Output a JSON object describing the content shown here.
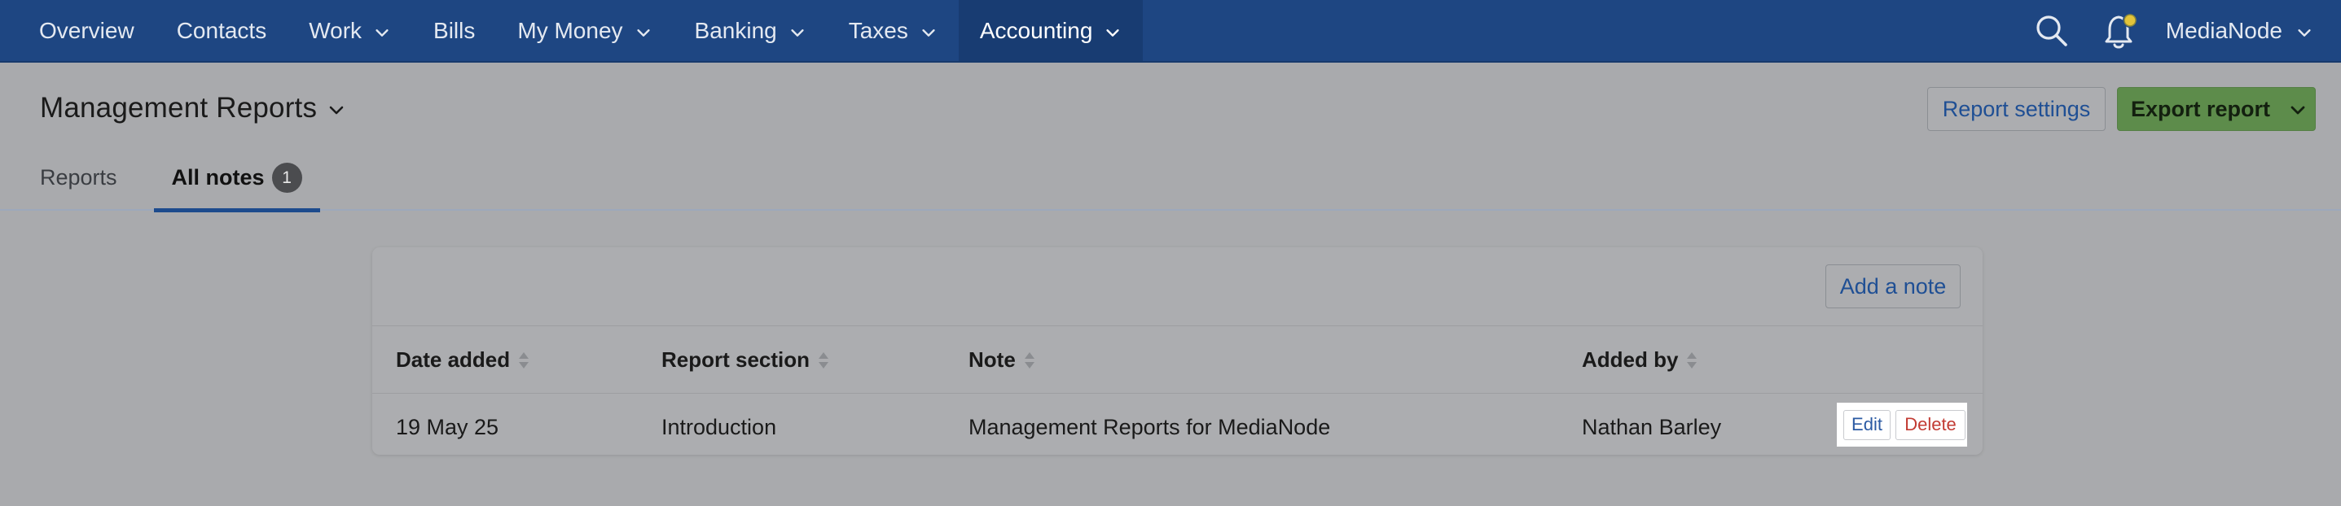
{
  "nav": {
    "items": [
      {
        "label": "Overview",
        "has_menu": false,
        "active": false
      },
      {
        "label": "Contacts",
        "has_menu": false,
        "active": false
      },
      {
        "label": "Work",
        "has_menu": true,
        "active": false
      },
      {
        "label": "Bills",
        "has_menu": false,
        "active": false
      },
      {
        "label": "My Money",
        "has_menu": true,
        "active": false
      },
      {
        "label": "Banking",
        "has_menu": true,
        "active": false
      },
      {
        "label": "Taxes",
        "has_menu": true,
        "active": false
      },
      {
        "label": "Accounting",
        "has_menu": true,
        "active": true
      }
    ],
    "search_icon": "search-icon",
    "notification_icon": "bell-icon",
    "notification_indicator_color": "#e3c43a",
    "user_label": "MediaNode"
  },
  "header": {
    "title": "Management Reports",
    "report_settings_label": "Report settings",
    "export_label": "Export report"
  },
  "tabs": [
    {
      "label": "Reports",
      "active": false
    },
    {
      "label": "All notes",
      "active": true,
      "badge": "1"
    }
  ],
  "notes": {
    "add_note_label": "Add a note",
    "columns": [
      "Date added",
      "Report section",
      "Note",
      "Added by"
    ],
    "rows": [
      {
        "date": "19 May 25",
        "section": "Introduction",
        "note": "Management Reports for MediaNode",
        "added_by": "Nathan Barley"
      }
    ],
    "edit_label": "Edit",
    "delete_label": "Delete"
  },
  "colors": {
    "nav_background": "#1e4682",
    "accent": "#1d4b8d",
    "export_button": "#5d8c4b",
    "delete_text": "#c23b33"
  }
}
